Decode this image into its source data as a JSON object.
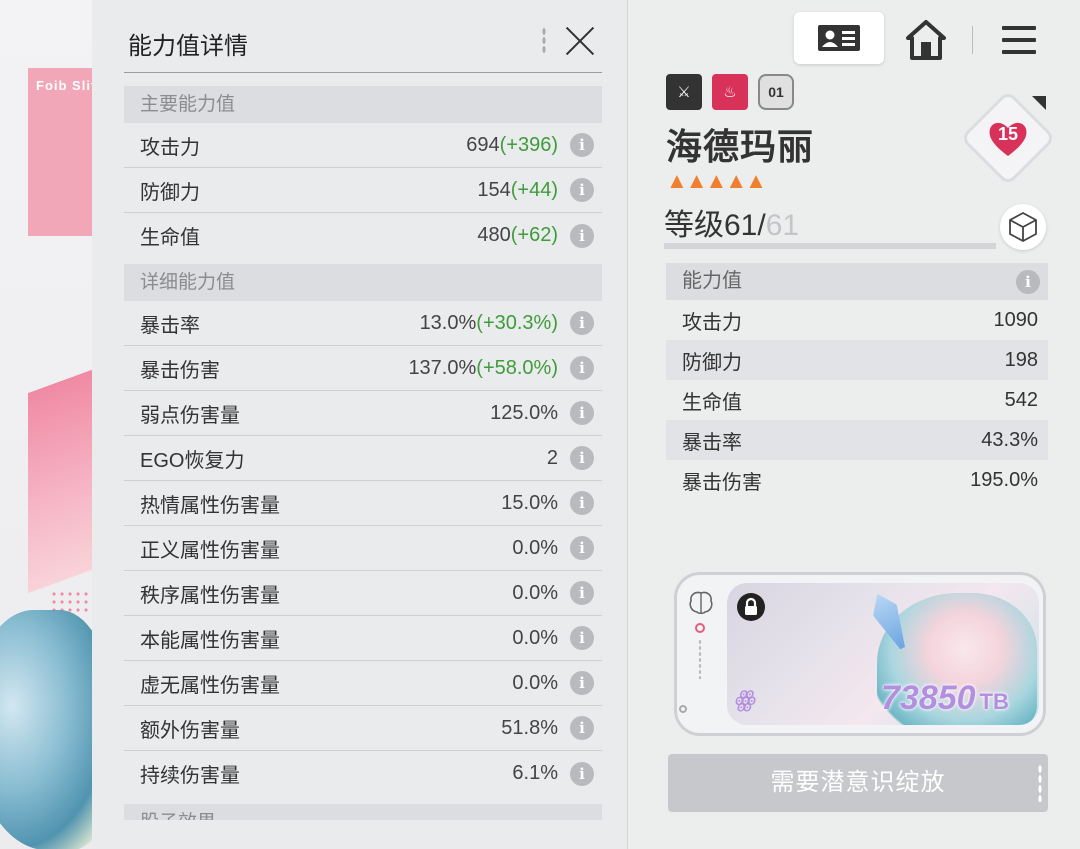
{
  "background": {
    "logo_text": "Foib Slit"
  },
  "left_panel": {
    "title": "能力值详情",
    "sections": [
      {
        "header": "主要能力值",
        "rows": [
          {
            "label": "攻击力",
            "value": "694",
            "bonus": "(+396)"
          },
          {
            "label": "防御力",
            "value": "154",
            "bonus": "(+44)"
          },
          {
            "label": "生命值",
            "value": "480",
            "bonus": "(+62)"
          }
        ]
      },
      {
        "header": "详细能力值",
        "rows": [
          {
            "label": "暴击率",
            "value": "13.0%",
            "bonus": "(+30.3%)"
          },
          {
            "label": "暴击伤害",
            "value": "137.0%",
            "bonus": "(+58.0%)"
          },
          {
            "label": "弱点伤害量",
            "value": "125.0%",
            "bonus": ""
          },
          {
            "label": "EGO恢复力",
            "value": "2",
            "bonus": ""
          },
          {
            "label": "热情属性伤害量",
            "value": "15.0%",
            "bonus": ""
          },
          {
            "label": "正义属性伤害量",
            "value": "0.0%",
            "bonus": ""
          },
          {
            "label": "秩序属性伤害量",
            "value": "0.0%",
            "bonus": ""
          },
          {
            "label": "本能属性伤害量",
            "value": "0.0%",
            "bonus": ""
          },
          {
            "label": "虚无属性伤害量",
            "value": "0.0%",
            "bonus": ""
          },
          {
            "label": "额外伤害量",
            "value": "51.8%",
            "bonus": ""
          },
          {
            "label": "持续伤害量",
            "value": "6.1%",
            "bonus": ""
          }
        ]
      },
      {
        "header": "股子效果",
        "rows": []
      }
    ],
    "info_icon": "i"
  },
  "header": {
    "profile_icon": "id-card-icon",
    "home_icon": "home-icon",
    "menu_icon": "hamburger-menu-icon"
  },
  "character": {
    "badges": [
      "⚔",
      "♨",
      "01"
    ],
    "name": "海德玛丽",
    "stars": "▲▲▲▲▲",
    "level_current": "等级61/",
    "level_max": "61",
    "affection": "15"
  },
  "ability": {
    "header": "能力值",
    "rows": [
      {
        "label": "攻击力",
        "value": "1090"
      },
      {
        "label": "防御力",
        "value": "198"
      },
      {
        "label": "生命值",
        "value": "542"
      },
      {
        "label": "暴击率",
        "value": "43.3%"
      },
      {
        "label": "暴击伤害",
        "value": "195.0%"
      }
    ]
  },
  "memory_card": {
    "value": "73850",
    "unit": "TB",
    "logo": "ꙮ"
  },
  "bloom_button": {
    "label": "需要潜意识绽放"
  },
  "colors": {
    "bonus_green": "#3f9c3a",
    "star_orange": "#f08030",
    "heart_pink": "#d8325a"
  }
}
